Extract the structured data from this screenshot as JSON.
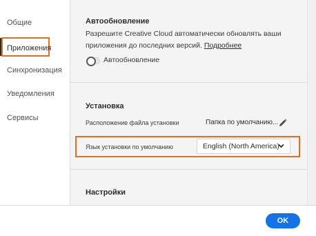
{
  "sidebar": {
    "items": [
      {
        "label": "Общие"
      },
      {
        "label": "Приложения"
      },
      {
        "label": "Синхронизация"
      },
      {
        "label": "Уведомления"
      },
      {
        "label": "Сервисы"
      }
    ],
    "active_index": 1
  },
  "auto_update": {
    "title": "Автообновление",
    "description_line1": "Разрешите Creative Cloud автоматически обновлять ваши",
    "description_line2": "приложения до последних версий.",
    "learn_more": "Подробнее",
    "toggle_label": "Автообновление",
    "toggle_on": false
  },
  "install": {
    "title": "Установка",
    "location_label": "Расположение файла установки",
    "location_value": "Папка по умолчанию...",
    "language_label": "Язык установки по умолчанию",
    "language_value": "English (North America)"
  },
  "settings": {
    "title": "Настройки"
  },
  "footer": {
    "ok_label": "OK"
  },
  "colors": {
    "accent": "#1473e6",
    "highlight": "#e07020"
  },
  "icons": {
    "edit": "pencil-icon",
    "dropdown": "chevron-down-icon"
  }
}
